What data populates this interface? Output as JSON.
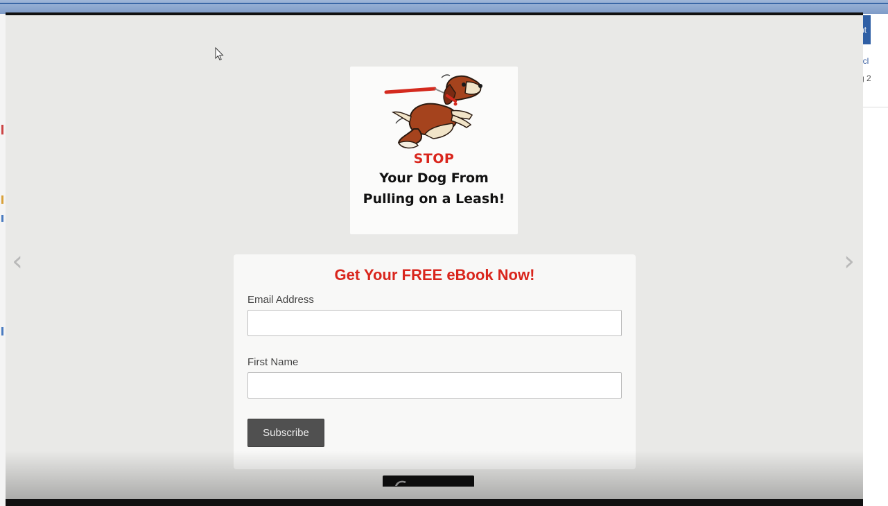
{
  "background": {
    "right_tab_text": "nt",
    "right_text_1": "icl",
    "right_text_2": "g 2"
  },
  "lightbox": {
    "prev_arrow_glyph": "‹",
    "next_arrow_glyph": "›"
  },
  "ebook": {
    "stop_text": "STOP",
    "line1": "Your Dog From",
    "line2": "Pulling on a Leash!",
    "illustration_icon": "dog-on-leash-icon"
  },
  "form": {
    "title": "Get Your FREE eBook Now!",
    "email_label": "Email Address",
    "email_value": "",
    "name_label": "First Name",
    "name_value": "",
    "subscribe_label": "Subscribe"
  },
  "colors": {
    "title_red": "#d9251c",
    "button_gray": "#505050",
    "lightbox_bg": "#e9e9e7"
  }
}
